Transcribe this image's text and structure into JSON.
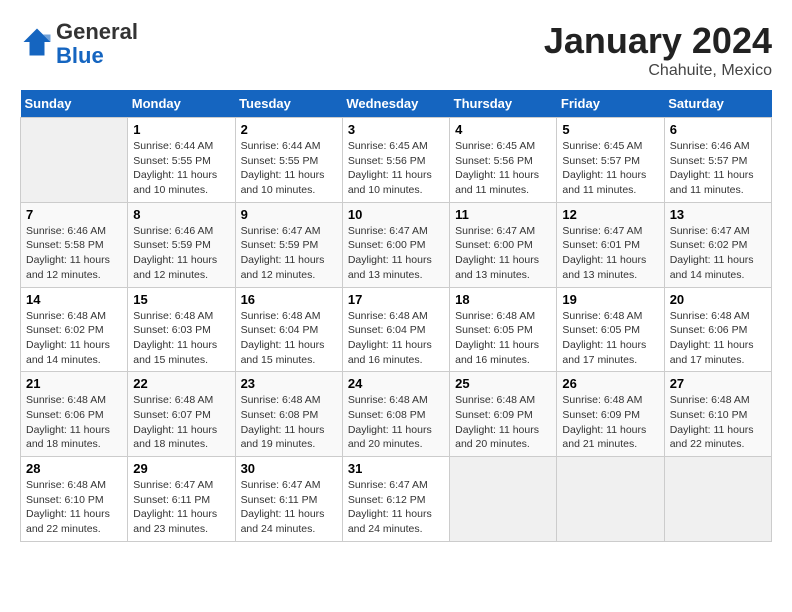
{
  "header": {
    "logo_line1": "General",
    "logo_line2": "Blue",
    "month": "January 2024",
    "location": "Chahuite, Mexico"
  },
  "weekdays": [
    "Sunday",
    "Monday",
    "Tuesday",
    "Wednesday",
    "Thursday",
    "Friday",
    "Saturday"
  ],
  "weeks": [
    [
      {
        "day": "",
        "sunrise": "",
        "sunset": "",
        "daylight": ""
      },
      {
        "day": "1",
        "sunrise": "Sunrise: 6:44 AM",
        "sunset": "Sunset: 5:55 PM",
        "daylight": "Daylight: 11 hours and 10 minutes."
      },
      {
        "day": "2",
        "sunrise": "Sunrise: 6:44 AM",
        "sunset": "Sunset: 5:55 PM",
        "daylight": "Daylight: 11 hours and 10 minutes."
      },
      {
        "day": "3",
        "sunrise": "Sunrise: 6:45 AM",
        "sunset": "Sunset: 5:56 PM",
        "daylight": "Daylight: 11 hours and 10 minutes."
      },
      {
        "day": "4",
        "sunrise": "Sunrise: 6:45 AM",
        "sunset": "Sunset: 5:56 PM",
        "daylight": "Daylight: 11 hours and 11 minutes."
      },
      {
        "day": "5",
        "sunrise": "Sunrise: 6:45 AM",
        "sunset": "Sunset: 5:57 PM",
        "daylight": "Daylight: 11 hours and 11 minutes."
      },
      {
        "day": "6",
        "sunrise": "Sunrise: 6:46 AM",
        "sunset": "Sunset: 5:57 PM",
        "daylight": "Daylight: 11 hours and 11 minutes."
      }
    ],
    [
      {
        "day": "7",
        "sunrise": "Sunrise: 6:46 AM",
        "sunset": "Sunset: 5:58 PM",
        "daylight": "Daylight: 11 hours and 12 minutes."
      },
      {
        "day": "8",
        "sunrise": "Sunrise: 6:46 AM",
        "sunset": "Sunset: 5:59 PM",
        "daylight": "Daylight: 11 hours and 12 minutes."
      },
      {
        "day": "9",
        "sunrise": "Sunrise: 6:47 AM",
        "sunset": "Sunset: 5:59 PM",
        "daylight": "Daylight: 11 hours and 12 minutes."
      },
      {
        "day": "10",
        "sunrise": "Sunrise: 6:47 AM",
        "sunset": "Sunset: 6:00 PM",
        "daylight": "Daylight: 11 hours and 13 minutes."
      },
      {
        "day": "11",
        "sunrise": "Sunrise: 6:47 AM",
        "sunset": "Sunset: 6:00 PM",
        "daylight": "Daylight: 11 hours and 13 minutes."
      },
      {
        "day": "12",
        "sunrise": "Sunrise: 6:47 AM",
        "sunset": "Sunset: 6:01 PM",
        "daylight": "Daylight: 11 hours and 13 minutes."
      },
      {
        "day": "13",
        "sunrise": "Sunrise: 6:47 AM",
        "sunset": "Sunset: 6:02 PM",
        "daylight": "Daylight: 11 hours and 14 minutes."
      }
    ],
    [
      {
        "day": "14",
        "sunrise": "Sunrise: 6:48 AM",
        "sunset": "Sunset: 6:02 PM",
        "daylight": "Daylight: 11 hours and 14 minutes."
      },
      {
        "day": "15",
        "sunrise": "Sunrise: 6:48 AM",
        "sunset": "Sunset: 6:03 PM",
        "daylight": "Daylight: 11 hours and 15 minutes."
      },
      {
        "day": "16",
        "sunrise": "Sunrise: 6:48 AM",
        "sunset": "Sunset: 6:04 PM",
        "daylight": "Daylight: 11 hours and 15 minutes."
      },
      {
        "day": "17",
        "sunrise": "Sunrise: 6:48 AM",
        "sunset": "Sunset: 6:04 PM",
        "daylight": "Daylight: 11 hours and 16 minutes."
      },
      {
        "day": "18",
        "sunrise": "Sunrise: 6:48 AM",
        "sunset": "Sunset: 6:05 PM",
        "daylight": "Daylight: 11 hours and 16 minutes."
      },
      {
        "day": "19",
        "sunrise": "Sunrise: 6:48 AM",
        "sunset": "Sunset: 6:05 PM",
        "daylight": "Daylight: 11 hours and 17 minutes."
      },
      {
        "day": "20",
        "sunrise": "Sunrise: 6:48 AM",
        "sunset": "Sunset: 6:06 PM",
        "daylight": "Daylight: 11 hours and 17 minutes."
      }
    ],
    [
      {
        "day": "21",
        "sunrise": "Sunrise: 6:48 AM",
        "sunset": "Sunset: 6:06 PM",
        "daylight": "Daylight: 11 hours and 18 minutes."
      },
      {
        "day": "22",
        "sunrise": "Sunrise: 6:48 AM",
        "sunset": "Sunset: 6:07 PM",
        "daylight": "Daylight: 11 hours and 18 minutes."
      },
      {
        "day": "23",
        "sunrise": "Sunrise: 6:48 AM",
        "sunset": "Sunset: 6:08 PM",
        "daylight": "Daylight: 11 hours and 19 minutes."
      },
      {
        "day": "24",
        "sunrise": "Sunrise: 6:48 AM",
        "sunset": "Sunset: 6:08 PM",
        "daylight": "Daylight: 11 hours and 20 minutes."
      },
      {
        "day": "25",
        "sunrise": "Sunrise: 6:48 AM",
        "sunset": "Sunset: 6:09 PM",
        "daylight": "Daylight: 11 hours and 20 minutes."
      },
      {
        "day": "26",
        "sunrise": "Sunrise: 6:48 AM",
        "sunset": "Sunset: 6:09 PM",
        "daylight": "Daylight: 11 hours and 21 minutes."
      },
      {
        "day": "27",
        "sunrise": "Sunrise: 6:48 AM",
        "sunset": "Sunset: 6:10 PM",
        "daylight": "Daylight: 11 hours and 22 minutes."
      }
    ],
    [
      {
        "day": "28",
        "sunrise": "Sunrise: 6:48 AM",
        "sunset": "Sunset: 6:10 PM",
        "daylight": "Daylight: 11 hours and 22 minutes."
      },
      {
        "day": "29",
        "sunrise": "Sunrise: 6:47 AM",
        "sunset": "Sunset: 6:11 PM",
        "daylight": "Daylight: 11 hours and 23 minutes."
      },
      {
        "day": "30",
        "sunrise": "Sunrise: 6:47 AM",
        "sunset": "Sunset: 6:11 PM",
        "daylight": "Daylight: 11 hours and 24 minutes."
      },
      {
        "day": "31",
        "sunrise": "Sunrise: 6:47 AM",
        "sunset": "Sunset: 6:12 PM",
        "daylight": "Daylight: 11 hours and 24 minutes."
      },
      {
        "day": "",
        "sunrise": "",
        "sunset": "",
        "daylight": ""
      },
      {
        "day": "",
        "sunrise": "",
        "sunset": "",
        "daylight": ""
      },
      {
        "day": "",
        "sunrise": "",
        "sunset": "",
        "daylight": ""
      }
    ]
  ]
}
